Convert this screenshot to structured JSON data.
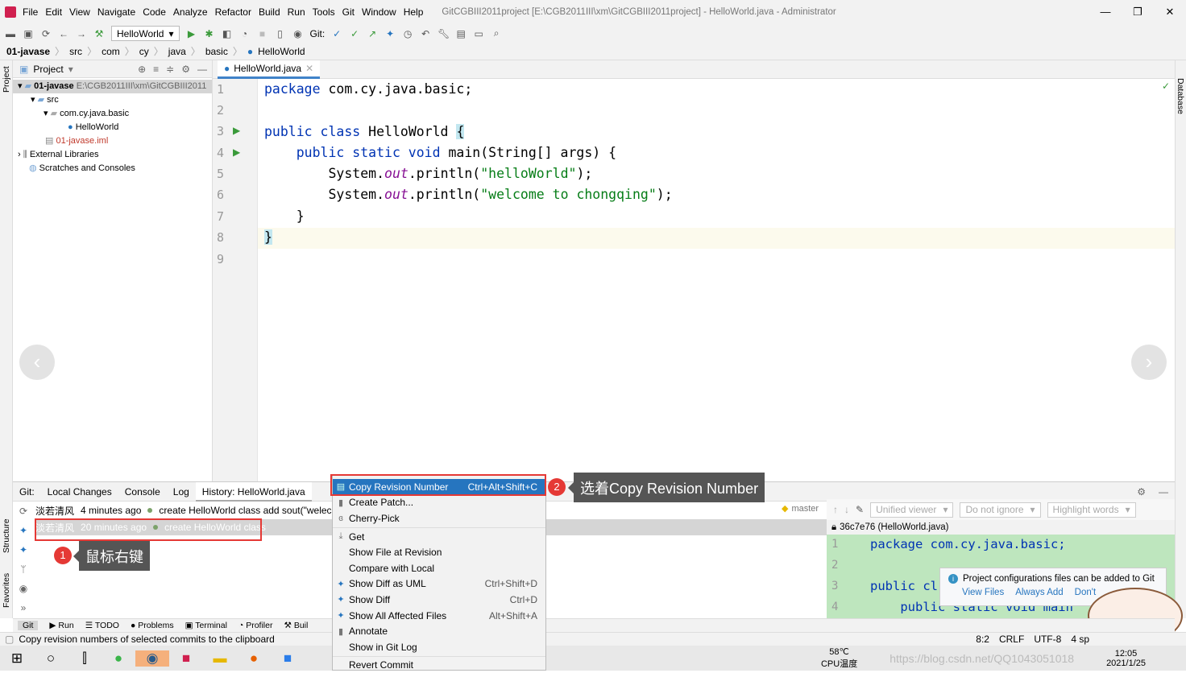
{
  "menubar": {
    "items": [
      "File",
      "Edit",
      "View",
      "Navigate",
      "Code",
      "Analyze",
      "Refactor",
      "Build",
      "Run",
      "Tools",
      "Git",
      "Window",
      "Help"
    ],
    "title": "GitCGBIII2011project [E:\\CGB2011III\\xm\\GitCGBIII2011project] - HelloWorld.java - Administrator"
  },
  "toolbar": {
    "run_config": "HelloWorld",
    "git_label": "Git:"
  },
  "breadcrumb": [
    "01-javase",
    "src",
    "com",
    "cy",
    "java",
    "basic",
    "HelloWorld"
  ],
  "project": {
    "header": "Project",
    "tree": [
      {
        "label": "01-javase",
        "extra": "E:\\CGB2011III\\xm\\GitCGBIII2011",
        "level": 0
      },
      {
        "label": "src",
        "level": 1
      },
      {
        "label": "com.cy.java.basic",
        "level": 2
      },
      {
        "label": "HelloWorld",
        "level": 3
      },
      {
        "label": "01-javase.iml",
        "level": 2
      },
      {
        "label": "External Libraries",
        "level": 0
      },
      {
        "label": "Scratches and Consoles",
        "level": 0
      }
    ]
  },
  "editor": {
    "tab": "HelloWorld.java",
    "lines": [
      "1",
      "2",
      "3",
      "4",
      "5",
      "6",
      "7",
      "8",
      "9"
    ]
  },
  "code": {
    "l1a": "package",
    "l1b": " com.cy.java.basic;",
    "l3a": "public class",
    "l3b": " HelloWorld ",
    "l3c": "{",
    "l4a": "    public static void",
    "l4b": " main(String[] args) {",
    "l5a": "        System.",
    "out": "out",
    "l5b": ".println(",
    "l5s": "\"helloWorld\"",
    "l5c": ");",
    "l6s": "\"welcome to chongqing\"",
    "l7": "    }",
    "l8": "}"
  },
  "bottom": {
    "tabs": [
      "Git:",
      "Local Changes",
      "Console",
      "Log",
      "History: HelloWorld.java"
    ],
    "history": [
      {
        "author": "淡若清风",
        "time": "4 minutes ago",
        "msg": "create HelloWorld class add sout(\"welecom"
      },
      {
        "author": "淡若清风",
        "time": "20 minutes ago",
        "msg": "create HelloWorld class"
      }
    ],
    "branch": "master",
    "viewer": "Unified viewer",
    "ignore": "Do not ignore",
    "highlight": "Highlight words",
    "diff_file": "36c7e76 (HelloWorld.java)",
    "diff_lines": [
      "1",
      "2",
      "3",
      "4"
    ],
    "diff_code": [
      "package com.cy.java.basic;",
      "",
      "public cl",
      "    public static void main"
    ]
  },
  "notification": {
    "text": "Project configurations files can be added to Git",
    "actions": [
      "View Files",
      "Always Add",
      "Don't"
    ]
  },
  "context_menu": [
    {
      "label": "Copy Revision Number",
      "shortcut": "Ctrl+Alt+Shift+C",
      "selected": true
    },
    {
      "label": "Create Patch..."
    },
    {
      "label": "Cherry-Pick"
    },
    {
      "sep": true
    },
    {
      "label": "Get"
    },
    {
      "label": "Show File at Revision"
    },
    {
      "label": "Compare with Local"
    },
    {
      "label": "Show Diff as UML",
      "shortcut": "Ctrl+Shift+D"
    },
    {
      "label": "Show Diff",
      "shortcut": "Ctrl+D"
    },
    {
      "label": "Show All Affected Files",
      "shortcut": "Alt+Shift+A"
    },
    {
      "label": "Annotate"
    },
    {
      "label": "Show in Git Log"
    },
    {
      "sep": true
    },
    {
      "label": "Revert Commit"
    }
  ],
  "annotations": {
    "a1_num": "1",
    "a1_text": "鼠标右键",
    "a2_num": "2",
    "a2_text": "选着Copy Revision Number"
  },
  "toolwindows": [
    "Git",
    "Run",
    "TODO",
    "Problems",
    "Terminal",
    "Profiler",
    "Buil"
  ],
  "side": {
    "project": "Project",
    "structure": "Structure",
    "favorites": "Favorites",
    "database": "Database"
  },
  "status": {
    "message": "Copy revision numbers of selected commits to the clipboard",
    "pos": "8:2",
    "eol": "CRLF",
    "enc": "UTF-8",
    "indent": "4 sp"
  },
  "taskbar": {
    "temp": "58℃",
    "temp_label": "CPU温度",
    "time": "12:05",
    "date": "2021/1/25",
    "watermark": "https://blog.csdn.net/QQ1043051018"
  },
  "colors": {
    "accent": "#2675bf",
    "annotation": "#e53935",
    "diff_added": "#bee6be"
  }
}
